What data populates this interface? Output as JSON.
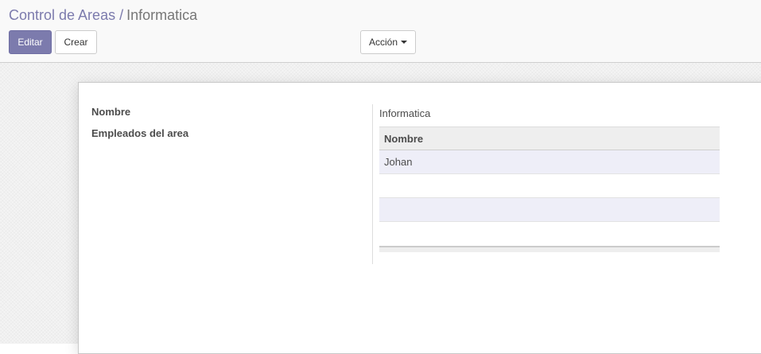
{
  "breadcrumb": {
    "parent": "Control de Areas",
    "separator": "/",
    "current": "Informatica"
  },
  "buttons": {
    "edit": "Editar",
    "create": "Crear",
    "action": "Acción"
  },
  "form": {
    "name_label": "Nombre",
    "name_value": "Informatica",
    "employees_label": "Empleados del area",
    "employees_table": {
      "columns": [
        "Nombre"
      ],
      "rows": [
        {
          "nombre": "Johan"
        },
        {
          "nombre": ""
        },
        {
          "nombre": ""
        },
        {
          "nombre": ""
        }
      ]
    }
  },
  "colors": {
    "primary": "#7c7bad",
    "row_stripe": "#eeeef8"
  }
}
